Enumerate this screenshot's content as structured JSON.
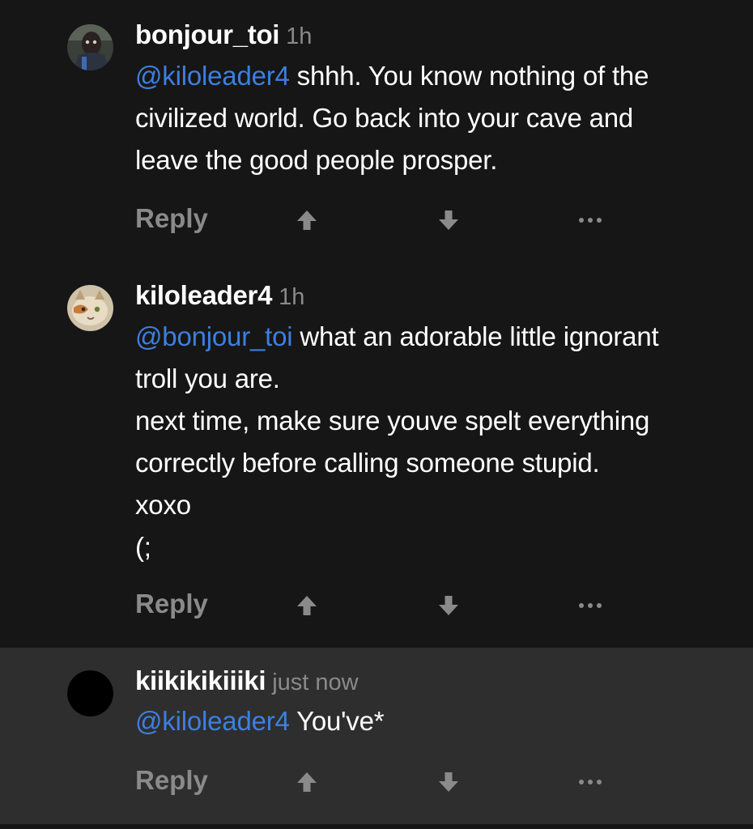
{
  "comments": [
    {
      "username": "bonjour_toi",
      "time": "1h",
      "mention": "@kiloleader4",
      "lines": [
        " shhh. You know nothing of the",
        "civilized world. Go back into your cave and",
        "leave the good people prosper."
      ],
      "reply_label": "Reply"
    },
    {
      "username": "kiloleader4",
      "time": "1h",
      "mention": "@bonjour_toi",
      "lines": [
        " what an adorable little ignorant",
        "troll you are.",
        "next time, make sure youve spelt everything",
        "correctly before calling someone stupid.",
        "xoxo",
        "(;"
      ],
      "reply_label": "Reply"
    },
    {
      "username": "kiikikikiiiki",
      "time": "just now",
      "mention": "@kiloleader4",
      "lines": [
        " You've*"
      ],
      "reply_label": "Reply"
    }
  ],
  "icons": {
    "upvote": "arrow-up-icon",
    "downvote": "arrow-down-icon",
    "more": "more-options-icon"
  },
  "colors": {
    "background": "#161616",
    "highlight_background": "#2e2e2e",
    "mention": "#3d7fe0",
    "muted": "#8a8a8a",
    "text": "#ffffff"
  }
}
